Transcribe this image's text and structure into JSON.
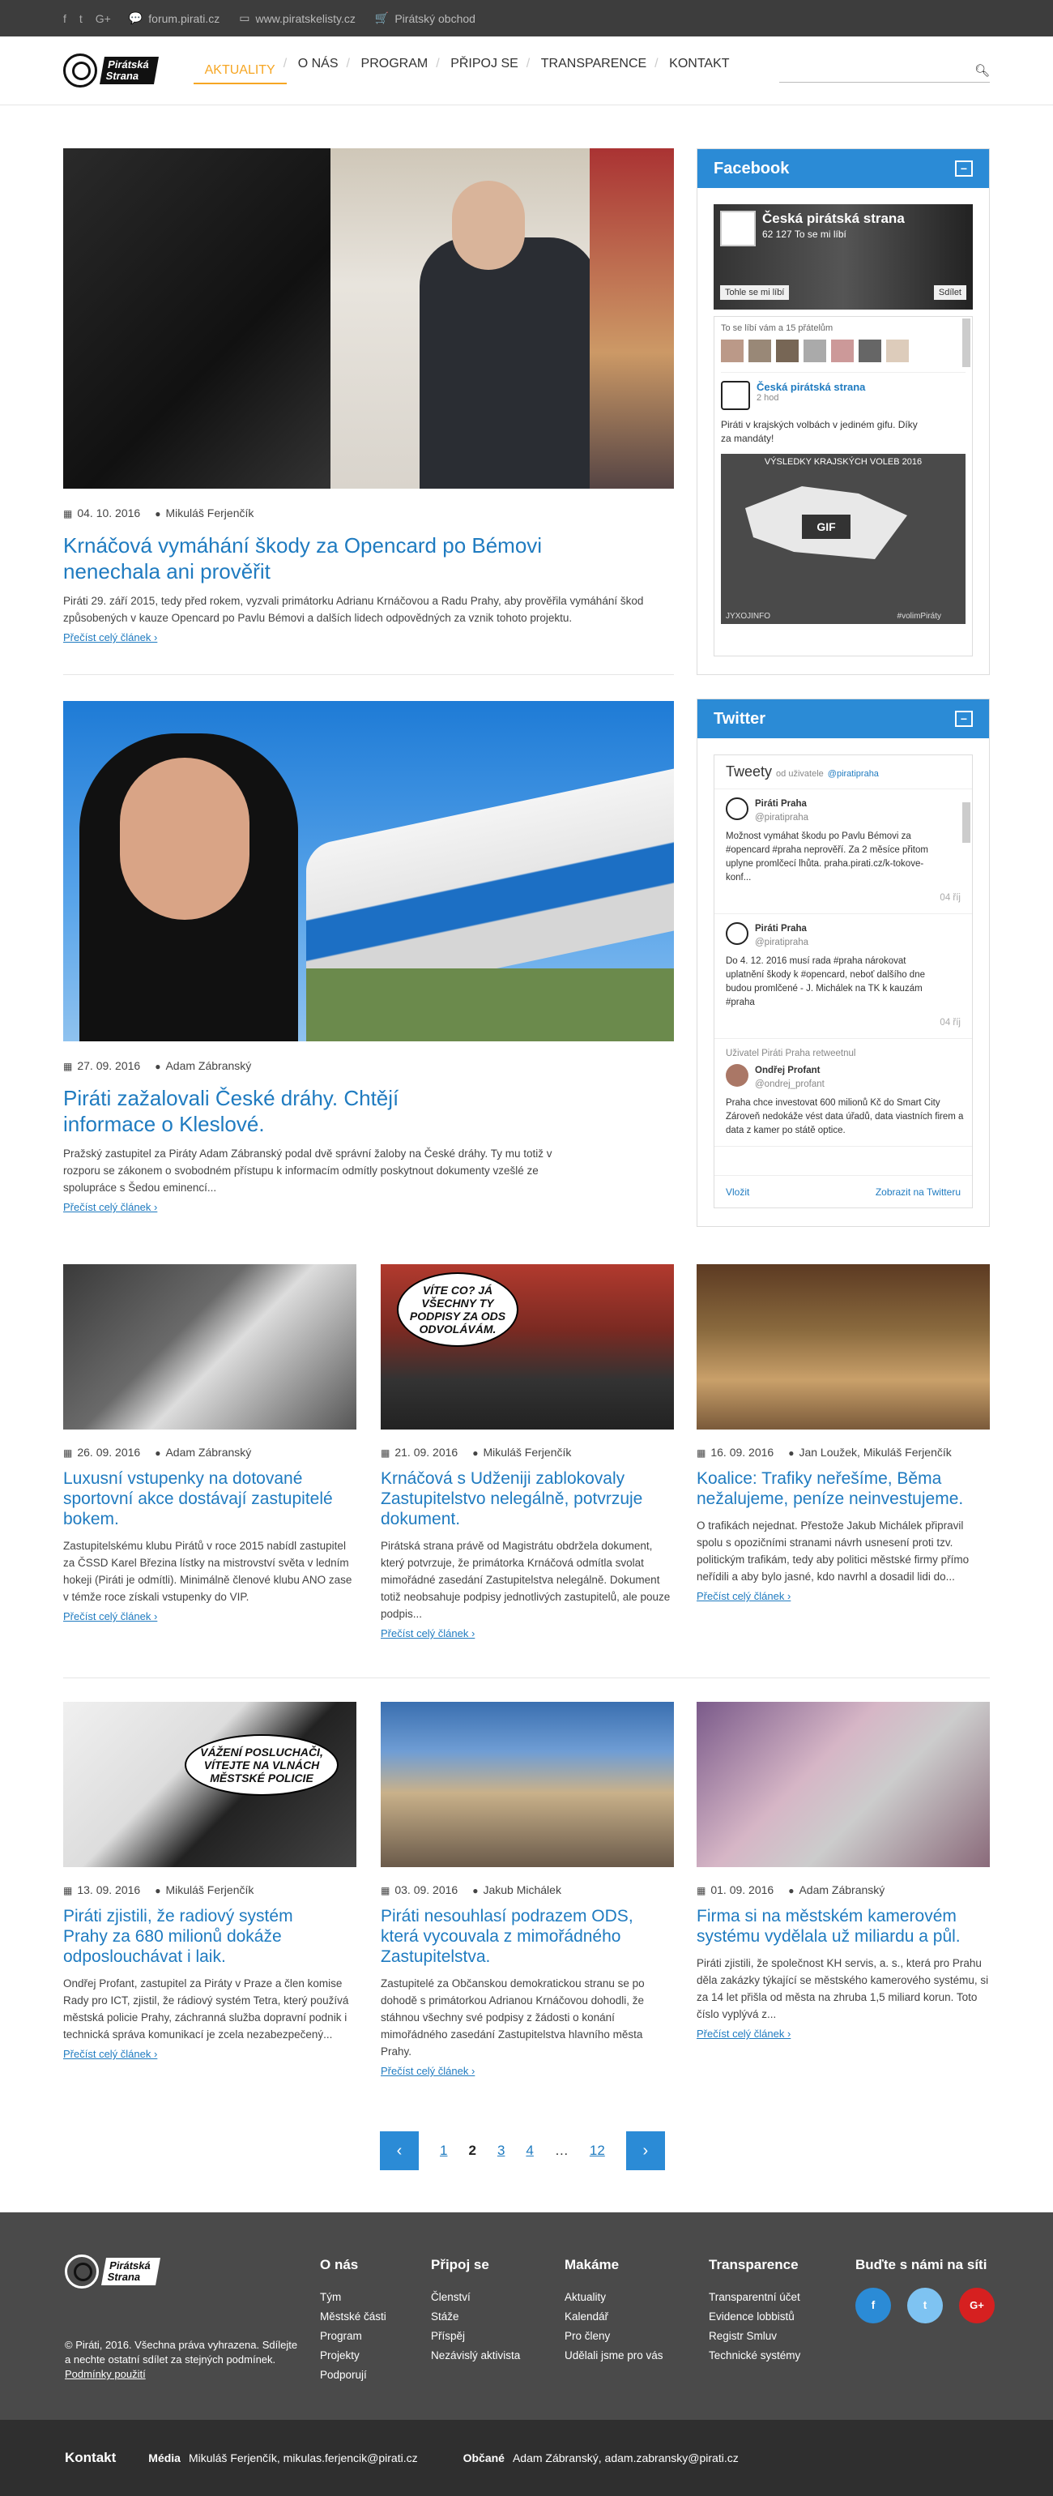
{
  "topbar": {
    "forum": "forum.pirati.cz",
    "lists": "www.piratskelisty.cz",
    "shop": "Pirátský obchod",
    "social": {
      "facebook": "f",
      "twitter": "t",
      "gplus": "G+"
    }
  },
  "logo": {
    "line1": "Pirátská",
    "line2": "Strana"
  },
  "menu": [
    "AKTUALITY",
    "O NÁS",
    "PROGRAM",
    "PŘIPOJ SE",
    "TRANSPARENCE",
    "KONTAKT"
  ],
  "search": {
    "placeholder": ""
  },
  "featured": [
    {
      "date": "04. 10. 2016",
      "author": "Mikuláš Ferjenčík",
      "title": "Krnáčová vymáhání škody za Opencard po Bémovi nenechala ani prověřit",
      "excerpt": "Piráti 29. září 2015, tedy před rokem, vyzvali primátorku Adrianu Krnáčovou a Radu Prahy, aby prověřila vymáhání škod způsobených v kauze Opencard po Pavlu Bémovi a dalších lidech odpovědných za vznik tohoto projektu.",
      "more": "Přečíst celý článek ›"
    },
    {
      "date": "27. 09. 2016",
      "author": "Adam Zábranský",
      "title": "Piráti zažalovali České dráhy. Chtějí informace o Kleslové.",
      "excerpt": "Pražský zastupitel za Piráty Adam Zábranský podal dvě správní žaloby na České dráhy. Ty mu totiž v rozporu se zákonem o svobodném přístupu k informacím odmítly poskytnout dokumenty vzešlé ze spolupráce s Šedou eminencí...",
      "more": "Přečíst celý článek ›"
    }
  ],
  "cards": [
    {
      "date": "26. 09. 2016",
      "author": "Adam Zábranský",
      "title": "Luxusní vstupenky na dotované sportovní akce dostávají zastupitelé bokem.",
      "excerpt": "Zastupitelskému klubu Pirátů v roce 2015 nabídl zastupitel za ČSSD Karel Březina lístky na mistrovství světa v ledním hokeji (Piráti je odmítli). Minimálně členové klubu ANO zase v témže roce získali vstupenky do VIP.",
      "more": "Přečíst celý článek ›",
      "bubble": ""
    },
    {
      "date": "21. 09. 2016",
      "author": "Mikuláš Ferjenčík",
      "title": "Krnáčová s Udženiji zablokovaly Zastupitelstvo nelegálně, potvrzuje dokument.",
      "excerpt": "Pirátská strana právě od Magistrátu obdržela dokument, který potvrzuje, že primátorka Krnáčová odmítla svolat mimořádné zasedání Zastupitelstva nelegálně. Dokument totiž neobsahuje podpisy jednotlivých zastupitelů, ale pouze podpis...",
      "more": "Přečíst celý článek ›",
      "bubble": "VÍTE CO? JÁ VŠECHNY TY PODPISY ZA ODS ODVOLÁVÁM."
    },
    {
      "date": "16. 09. 2016",
      "author": "Jan Loužek, Mikuláš Ferjenčík",
      "title": "Koalice: Trafiky neřešíme, Běma nežalujeme, peníze neinvestujeme.",
      "excerpt": "O trafikách nejednat. Přestože Jakub Michálek připravil spolu s opozičními stranami návrh usnesení proti tzv. politickým trafikám, tedy aby politici městské firmy přímo neřídili a aby bylo jasné, kdo navrhl a dosadil lidi do...",
      "more": "Přečíst celý článek ›",
      "bubble": ""
    },
    {
      "date": "13. 09. 2016",
      "author": "Mikuláš Ferjenčík",
      "title": "Piráti zjistili, že radiový systém Prahy za 680 milionů dokáže odposlouchávat i laik.",
      "excerpt": "Ondřej Profant, zastupitel za Piráty v Praze a člen komise Rady pro ICT, zjistil, že rádiový systém Tetra, který používá městská policie Prahy, záchranná služba dopravní podnik i technická správa komunikací je zcela nezabezpečený...",
      "more": "Přečíst celý článek ›",
      "bubble": "VÁŽENÍ POSLUCHAČI, VÍTEJTE NA VLNÁCH MĚSTSKÉ POLICIE"
    },
    {
      "date": "03. 09. 2016",
      "author": "Jakub Michálek",
      "title": "Piráti nesouhlasí podrazem ODS, která vycouvala z mimořádného Zastupitelstva.",
      "excerpt": "Zastupitelé za Občanskou demokratickou stranu se po dohodě s primátorkou Adrianou Krnáčovou dohodli, že stáhnou všechny své podpisy z žádosti o konání mimořádného zasedání Zastupitelstva hlavního města Prahy.",
      "more": "Přečíst celý článek ›",
      "bubble": ""
    },
    {
      "date": "01. 09. 2016",
      "author": "Adam Zábranský",
      "title": "Firma si na městském kamerovém systému vydělala už miliardu a půl.",
      "excerpt": "Piráti zjistili, že společnost KH servis, a. s., která pro Prahu děla zakázky týkající se městského kamerového systému, si za 14 let přišla od města na zhruba 1,5 miliard korun. Toto číslo vyplývá z...",
      "more": "Přečíst celý článek ›",
      "bubble": ""
    }
  ],
  "facebook": {
    "title": "Facebook",
    "page": "Česká pirátská strana",
    "likes": "62 127 To se mi líbí",
    "like_btn": "Tohle se mi líbí",
    "share_btn": "Sdílet",
    "friends": "To se líbí vám a 15 přátelům",
    "post_author": "Česká pirátská strana",
    "post_time": "2 hod",
    "post_text": "Piráti v krajských volbách v jediném gifu. Díky za mandáty!",
    "img_caption": "VÝSLEDKY KRAJSKÝCH VOLEB 2016",
    "gif": "GIF",
    "hashtag": "#volimPiráty",
    "logo_small": "JYXOJINFO"
  },
  "twitter": {
    "title": "Twitter",
    "tweets_label": "Tweety",
    "by": "od uživatele",
    "handle": "@piratipraha",
    "items": [
      {
        "name": "Piráti Praha",
        "handle": "@piratipraha",
        "text": "Možnost vymáhat škodu po Pavlu Bémovi za #opencard #praha neprověří. Za 2 měsíce přitom uplyne promlčecí lhůta. praha.pirati.cz/k-tokove-konf...",
        "time": "04 říj"
      },
      {
        "name": "Piráti Praha",
        "handle": "@piratipraha",
        "text": "Do 4. 12. 2016 musí rada #praha nárokovat uplatnění škody k #opencard, neboť dalšího dne budou promlčené - J. Michálek na TK k kauzám #praha",
        "time": "04 říj"
      },
      {
        "name": "Ondřej Profant",
        "handle": "@ondrej_profant",
        "text": "Praha chce investovat 600 milionů Kč do Smart City Zároveň nedokáže vést data úřadů, data viastních firem a data z kamer po státě optice.",
        "time": "",
        "retweet": "Uživatel Piráti Praha retweetnul"
      }
    ],
    "embed": "Vložit",
    "view": "Zobrazit na Twitteru"
  },
  "pagination": {
    "prev": "‹",
    "next": "›",
    "pages": [
      "1",
      "2",
      "3",
      "4",
      "…",
      "12"
    ],
    "current": "2"
  },
  "footer": {
    "copyright": "© Piráti, 2016. Všechna práva vyhrazena. Sdílejte a nechte ostatní sdílet za stejných podmínek.",
    "terms": "Podmínky použití",
    "cols": [
      {
        "title": "O nás",
        "items": [
          "Tým",
          "Městské části",
          "Program",
          "Projekty",
          "Podporují"
        ]
      },
      {
        "title": "Připoj se",
        "items": [
          "Členství",
          "Stáže",
          "Příspěj",
          "Nezávislý aktivista"
        ]
      },
      {
        "title": "Makáme",
        "items": [
          "Aktuality",
          "Kalendář",
          "Pro členy",
          "Udělali jsme pro vás"
        ]
      },
      {
        "title": "Transparence",
        "items": [
          "Transparentní účet",
          "Evidence lobbistů",
          "Registr Smluv",
          "Technické systémy"
        ]
      }
    ],
    "social_title": "Buďte s námi na síti",
    "social": {
      "fb": "f",
      "tw": "t",
      "gp": "G+"
    }
  },
  "bottom": {
    "contact": "Kontakt",
    "media_label": "Média",
    "media": "Mikuláš Ferjenčík, mikulas.ferjencik@pirati.cz",
    "citizens_label": "Občané",
    "citizens": "Adam Zábranský, adam.zabransky@pirati.cz"
  }
}
